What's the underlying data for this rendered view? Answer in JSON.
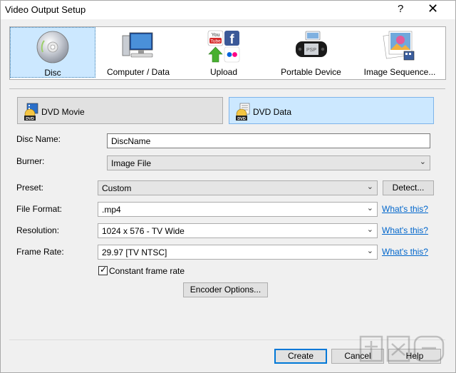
{
  "window": {
    "title": "Video Output Setup",
    "help_glyph": "?",
    "close_glyph": "✕"
  },
  "categories": [
    {
      "label": "Disc",
      "icon": "disc-icon",
      "selected": true
    },
    {
      "label": "Computer / Data",
      "icon": "computer-icon",
      "selected": false
    },
    {
      "label": "Upload",
      "icon": "upload-icon",
      "selected": false
    },
    {
      "label": "Portable Device",
      "icon": "portable-device-icon",
      "selected": false
    },
    {
      "label": "Image Sequence...",
      "icon": "image-sequence-icon",
      "selected": false
    }
  ],
  "disc_types": {
    "dvd_movie": "DVD Movie",
    "dvd_data": "DVD Data",
    "selected": "dvd_data"
  },
  "form": {
    "disc_name_label": "Disc Name:",
    "disc_name_value": "DiscName",
    "burner_label": "Burner:",
    "burner_value": "Image File",
    "preset_label": "Preset:",
    "preset_value": "Custom",
    "detect_button": "Detect...",
    "file_format_label": "File Format:",
    "file_format_value": ".mp4",
    "resolution_label": "Resolution:",
    "resolution_value": "1024 x 576 - TV Wide",
    "frame_rate_label": "Frame Rate:",
    "frame_rate_value": "29.97 [TV NTSC]",
    "whats_this": "What's this?",
    "constant_frame_rate_label": "Constant frame rate",
    "constant_frame_rate_checked": true,
    "encoder_options_button": "Encoder Options..."
  },
  "footer": {
    "create": "Create",
    "cancel": "Cancel",
    "help": "Help"
  },
  "colors": {
    "selection": "#cce8ff",
    "link": "#0066cc",
    "accent": "#0078d7"
  }
}
